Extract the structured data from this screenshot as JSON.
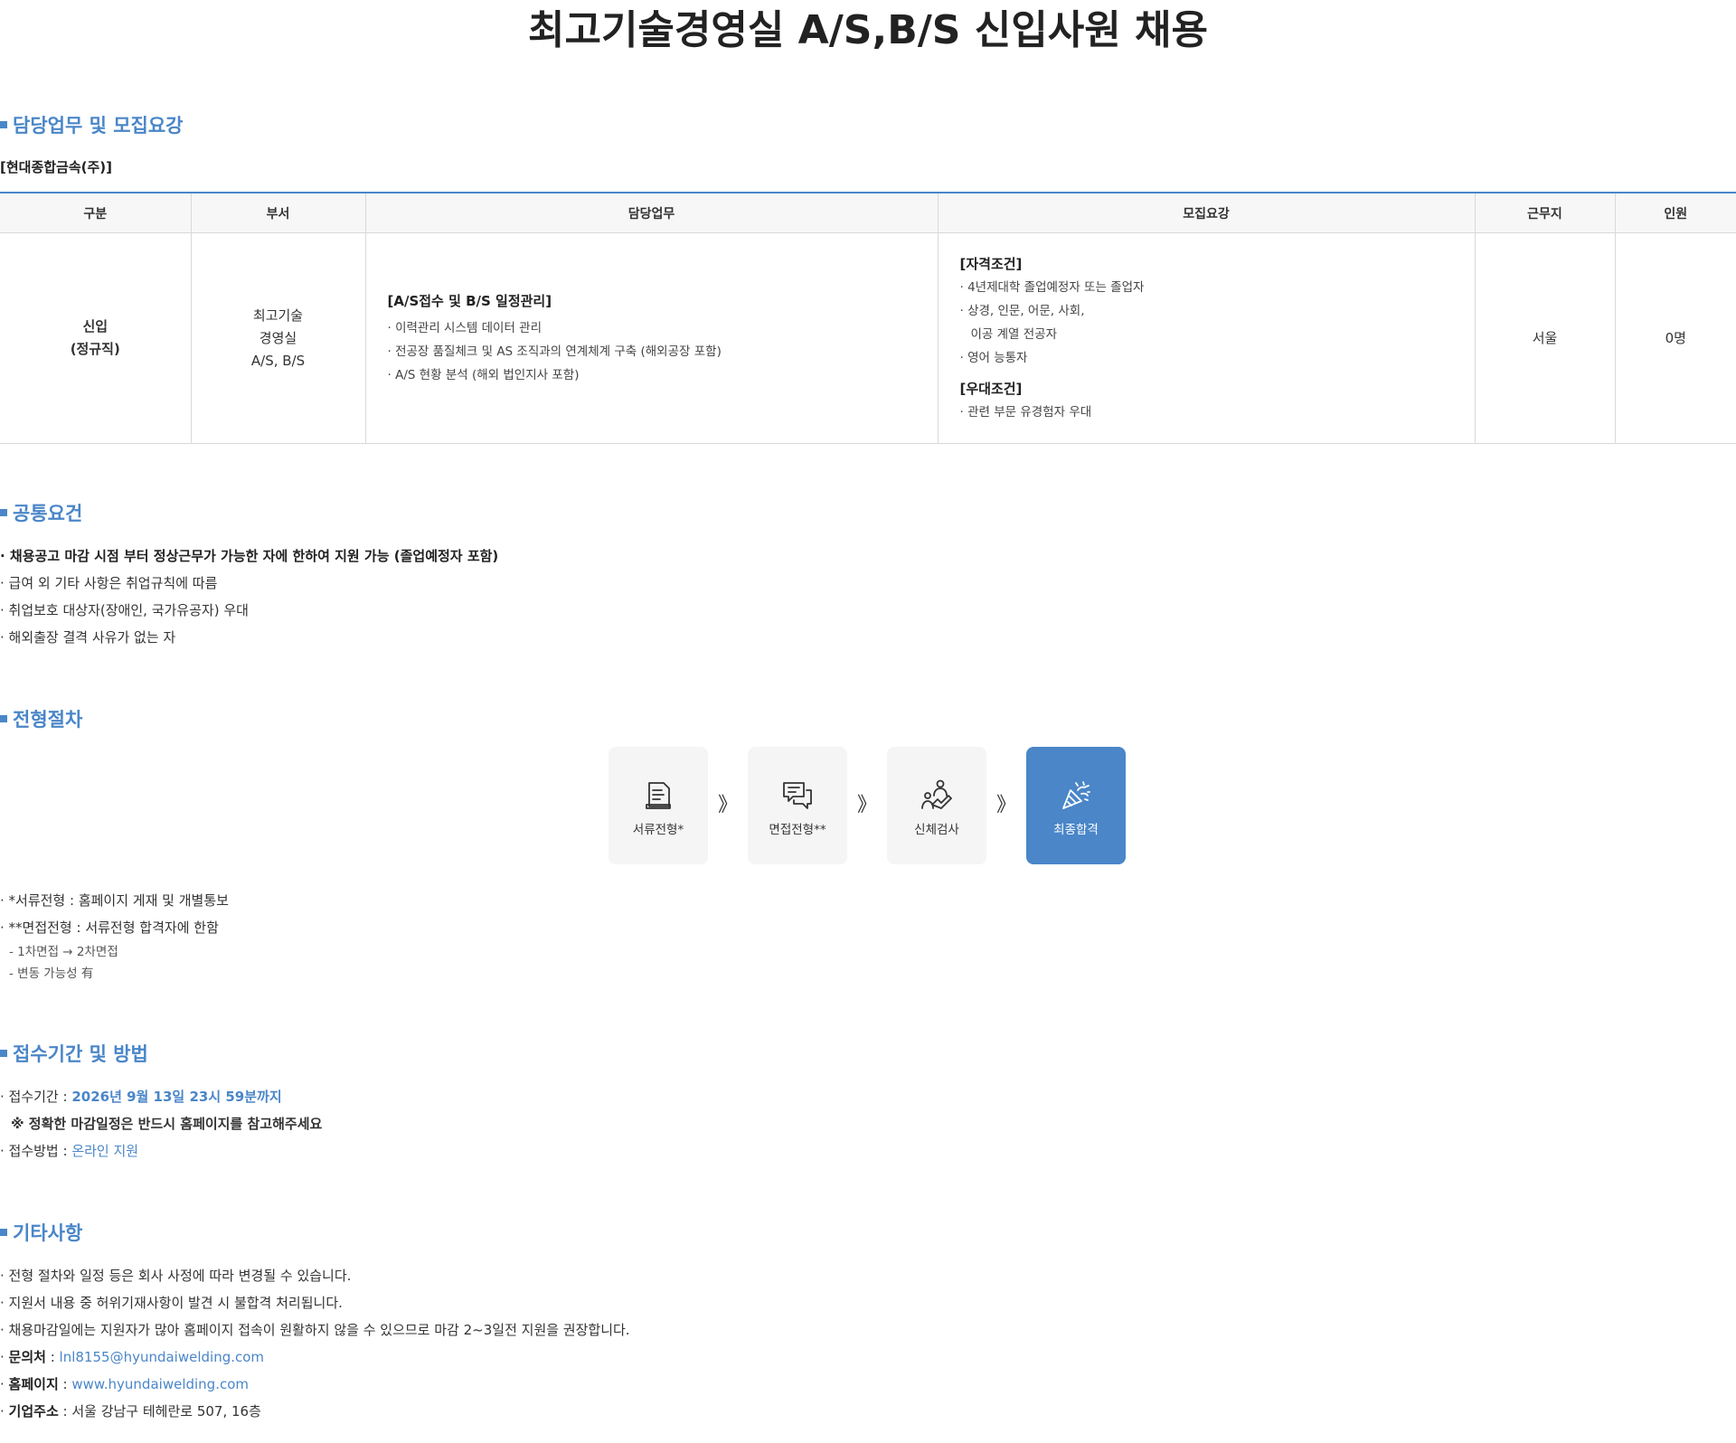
{
  "title": "최고기술경영실 A/S,B/S 신입사원 채용",
  "sections": {
    "duties": "담당업무 및 모집요강",
    "common": "공통요건",
    "process": "전형절차",
    "application": "접수기간 및 방법",
    "etc": "기타사항"
  },
  "company": "[현대종합금속(주)]",
  "table": {
    "headers": [
      "구분",
      "부서",
      "담당업무",
      "모집요강",
      "근무지",
      "인원"
    ],
    "type_line1": "신입",
    "type_line2": "(정규직)",
    "dept_line1": "최고기술",
    "dept_line2": "경영실",
    "dept_line3": "A/S, B/S",
    "duty_heading": "[A/S접수 및 B/S 일정관리]",
    "duty_items": [
      "· 이력관리 시스템 데이터 관리",
      "· 전공장 품질체크 및 AS 조직과의 연계체계 구축 (해외공장 포함)",
      "· A/S 현황 분석 (해외 법인지사 포함)"
    ],
    "req_heading": "[자격조건]",
    "req_items": [
      "· 4년제대학 졸업예정자 또는 졸업자",
      "· 상경, 인문, 어문, 사회,",
      "이공 계열 전공자",
      "· 영어 능통자"
    ],
    "pref_heading": "[우대조건]",
    "pref_items": [
      "· 관련 부문 유경험자 우대"
    ],
    "location": "서울",
    "headcount": "0명"
  },
  "common_items": [
    "· 채용공고 마감 시점 부터 정상근무가 가능한 자에 한하여 지원 가능 (졸업예정자 포함)",
    "· 급여 외 기타 사항은 취업규칙에 따름",
    "· 취업보호 대상자(장애인, 국가유공자) 우대",
    "· 해외출장 결격 사유가 없는 자"
  ],
  "process_steps": [
    {
      "label": "서류전형*",
      "icon": "document-icon"
    },
    {
      "label": "면접전형**",
      "icon": "chat-bubbles-icon"
    },
    {
      "label": "신체검사",
      "icon": "medical-check-icon"
    },
    {
      "label": "최종합격",
      "icon": "party-popper-icon"
    }
  ],
  "process_arrow": "》",
  "process_notes": [
    "· *서류전형 : 홈페이지 게재 및 개별통보",
    "· **면접전형 : 서류전형 합격자에 한함",
    "- 1차면접 → 2차면접",
    "- 변동 가능성 有"
  ],
  "application": {
    "period_label": "· 접수기간 : ",
    "period_value": "2026년 9월 13일 23시 59분까지",
    "period_note": "※ 정확한 마감일정은 반드시 홈페이지를 참고해주세요",
    "method_label": "· 접수방법 : ",
    "method_value": "온라인 지원"
  },
  "etc": {
    "items": [
      "· 전형 절차와 일정 등은 회사 사정에 따라 변경될 수 있습니다.",
      "· 지원서 내용 중 허위기재사항이 발견 시 불합격 처리됩니다.",
      "· 채용마감일에는 지원자가 많아 홈페이지 접속이 원활하지 않을 수 있으므로 마감 2~3일전 지원을 권장합니다."
    ],
    "contact_prefix": "· ",
    "contact_label": "문의처",
    "contact_sep": " : ",
    "contact_value": "lnl8155@hyundaiwelding.com",
    "homepage_prefix": "· ",
    "homepage_label": "홈페이지",
    "homepage_sep": " : ",
    "homepage_value": "www.hyundaiwelding.com",
    "address_prefix": "· ",
    "address_label": "기업주소",
    "address_sep": " : ",
    "address_value": "서울 강남구 테헤란로 507, 16층"
  },
  "colors": {
    "accent": "#4a86c8",
    "step_bg": "#f5f5f5",
    "header_bg": "#f7f7f7"
  }
}
